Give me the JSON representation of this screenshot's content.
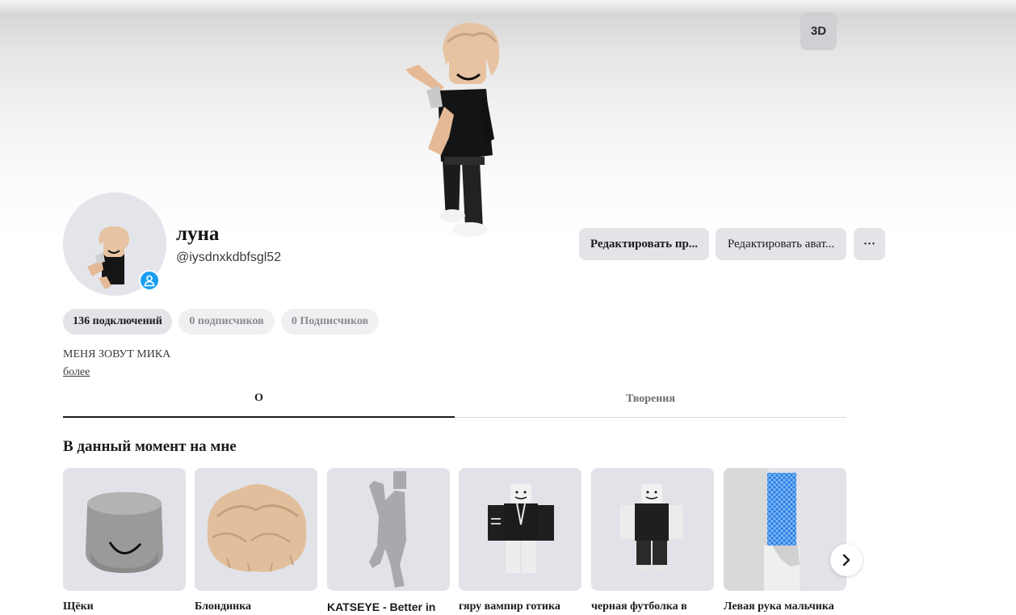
{
  "header": {
    "btn_3d_label": "3D"
  },
  "profile": {
    "display_name": "луна",
    "username": "@iysdnxkdbfsgl52",
    "edit_profile_label": "Редактировать пр...",
    "edit_avatar_label": "Редактировать ават...",
    "more_label": "···",
    "bio": "МЕНЯ ЗОВУТ МИКА",
    "more_link": "более"
  },
  "stats": {
    "connections": "136 подключений",
    "followers": "0 подписчиков",
    "following": "0 Подписчиков"
  },
  "tabs": {
    "about": "О",
    "creations": "Творения"
  },
  "wearing": {
    "title": "В данный момент на мне",
    "items": [
      {
        "name": "Щёки",
        "icon": "head-icon"
      },
      {
        "name": "Блондинка",
        "icon": "hair-icon"
      },
      {
        "name": "KATSEYE - Better in",
        "icon": "emote-icon"
      },
      {
        "name": "гяру вампир готика",
        "icon": "shirt-icon"
      },
      {
        "name": "черная футболка в",
        "icon": "tshirt-icon"
      },
      {
        "name": "Левая рука мальчика",
        "icon": "arm-icon"
      }
    ]
  },
  "colors": {
    "accent": "#1aa0f0",
    "button_bg": "#e3e4e8",
    "thumb_bg": "#e1e3e8"
  }
}
